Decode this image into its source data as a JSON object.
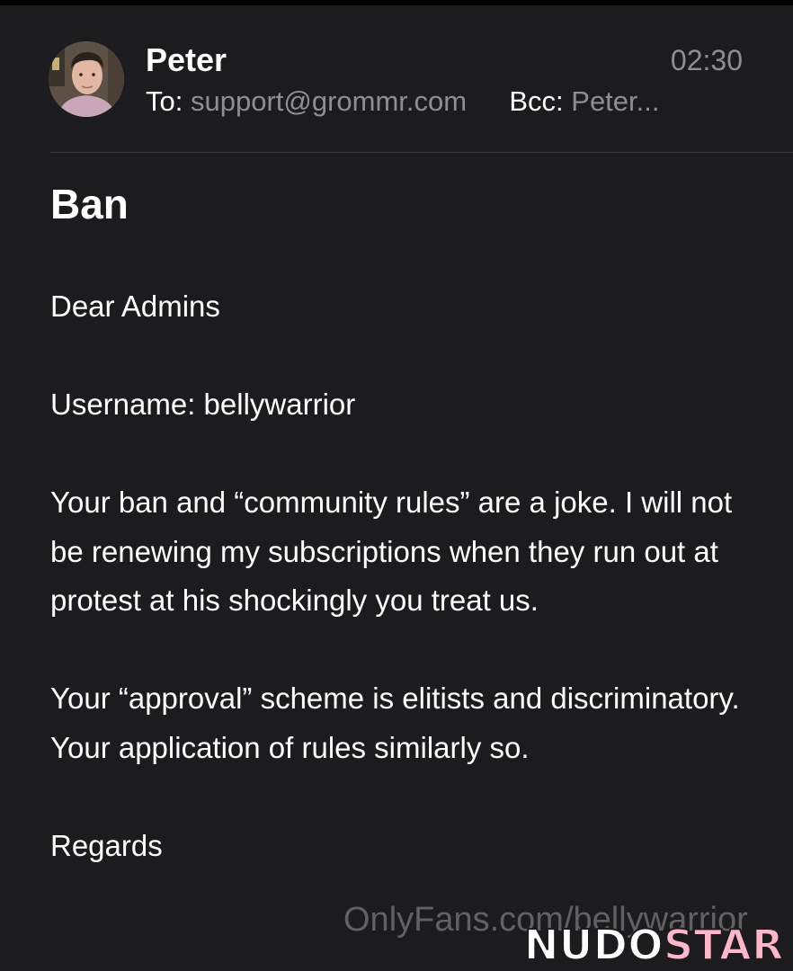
{
  "header": {
    "sender": "Peter",
    "time": "02:30",
    "to_label": "To:",
    "to_value": "support@grommr.com",
    "bcc_label": "Bcc:",
    "bcc_value": "Peter..."
  },
  "avatar_icon": "user-photo-avatar",
  "subject": "Ban",
  "body": {
    "greeting": "Dear Admins",
    "username_line": "Username: bellywarrior",
    "paragraph_1": "Your ban and “community rules” are a joke. I will not be renewing my subscriptions when they run out at protest at his shockingly you treat us.",
    "paragraph_2": "Your “approval” scheme is elitists and discriminatory. Your application of rules similarly so.",
    "signoff": "Regards"
  },
  "watermark": {
    "url_text": "OnlyFans.com/bellywarrior",
    "logo_part1": "NUDO",
    "logo_part2": "STAR"
  },
  "colors": {
    "background": "#1c1c1e",
    "secondary_text": "#8e8e93",
    "divider": "#3a3a3c",
    "logo_accent": "#ffb6c8"
  }
}
